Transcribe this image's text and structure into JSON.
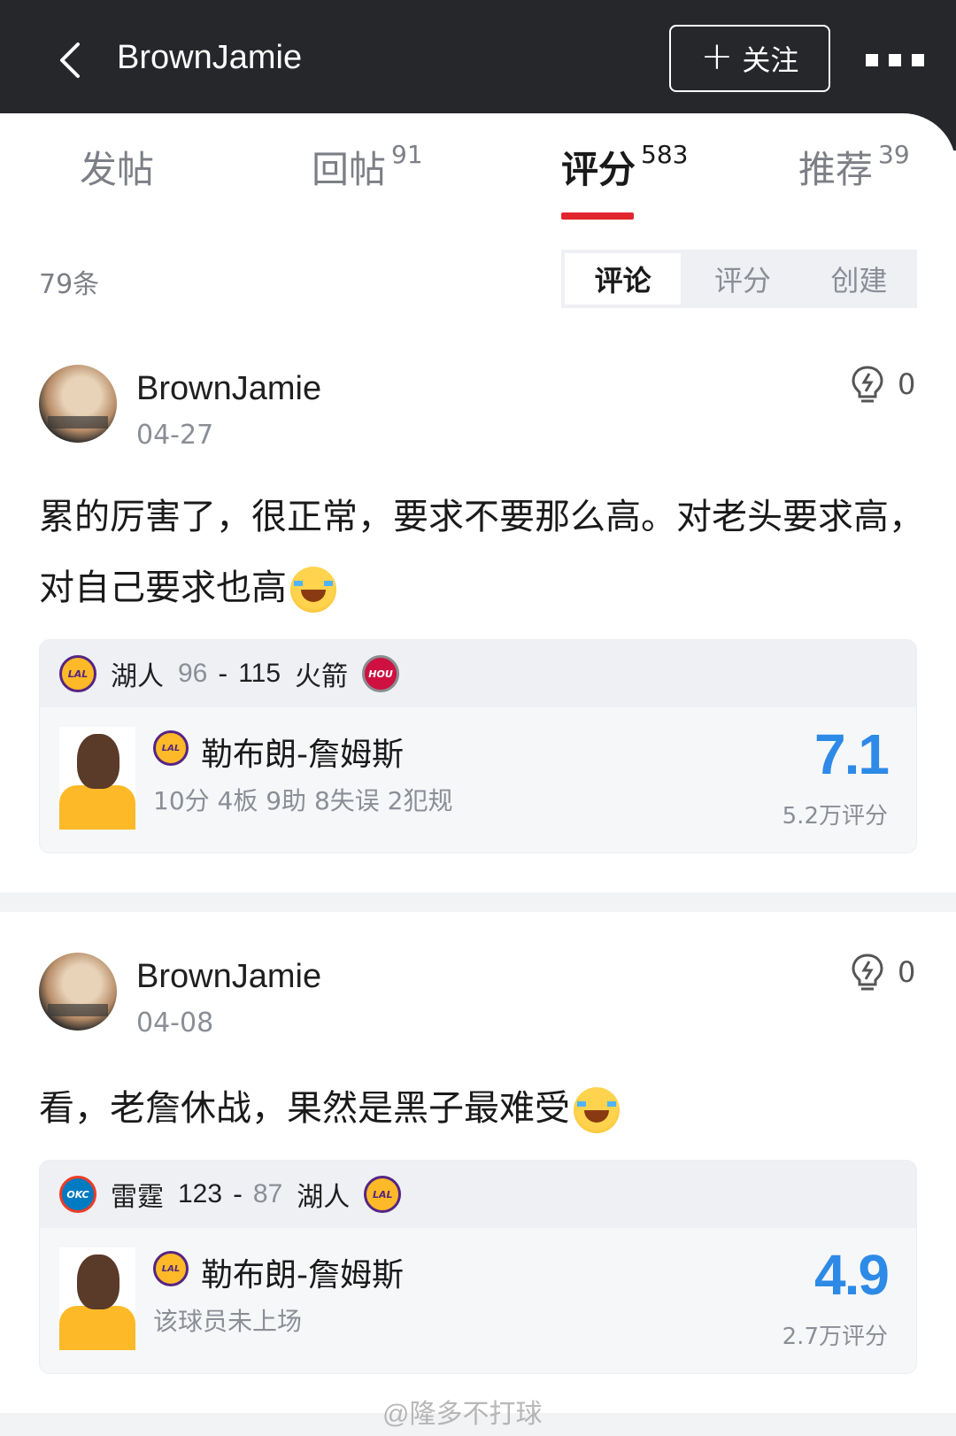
{
  "header": {
    "title": "BrownJamie",
    "follow_label": "关注",
    "follow_plus": "+"
  },
  "tabs": [
    {
      "label": "发帖",
      "count": ""
    },
    {
      "label": "回帖",
      "count": "91"
    },
    {
      "label": "评分",
      "count": "583"
    },
    {
      "label": "推荐",
      "count": "39"
    }
  ],
  "active_tab": "评分",
  "list": {
    "count_label": "79条",
    "segments": [
      "评论",
      "评分",
      "创建"
    ],
    "active_segment": "评论"
  },
  "posts": [
    {
      "username": "BrownJamie",
      "date": "04-27",
      "likes": "0",
      "text": "累的厉害了，很正常，要求不要那么高。对老头要求高，对自己要求也高",
      "game": {
        "home_team": "湖人",
        "home_logo": "LAL",
        "home_score": "96",
        "away_team": "火箭",
        "away_logo": "HOU",
        "away_score": "115"
      },
      "player": {
        "name": "勒布朗-詹姆斯",
        "team_logo": "LAL",
        "stats": "10分 4板 9助 8失误 2犯规",
        "rating": "7.1",
        "rating_count": "5.2万评分"
      }
    },
    {
      "username": "BrownJamie",
      "date": "04-08",
      "likes": "0",
      "text": "看，老詹休战，果然是黑子最难受",
      "game": {
        "home_team": "雷霆",
        "home_logo": "OKC",
        "home_score": "123",
        "away_team": "湖人",
        "away_logo": "LAL",
        "away_score": "87"
      },
      "player": {
        "name": "勒布朗-詹姆斯",
        "team_logo": "LAL",
        "stats": "该球员未上场",
        "rating": "4.9",
        "rating_count": "2.7万评分"
      }
    }
  ],
  "watermark": "@隆多不打球",
  "colors": {
    "header_bg": "#26272b",
    "accent_red": "#e2262d",
    "rating_blue": "#2d8ae6"
  },
  "icons": [
    "back-arrow-icon",
    "more-icon",
    "lightbulb-icon",
    "laughing-tears-emoji"
  ]
}
